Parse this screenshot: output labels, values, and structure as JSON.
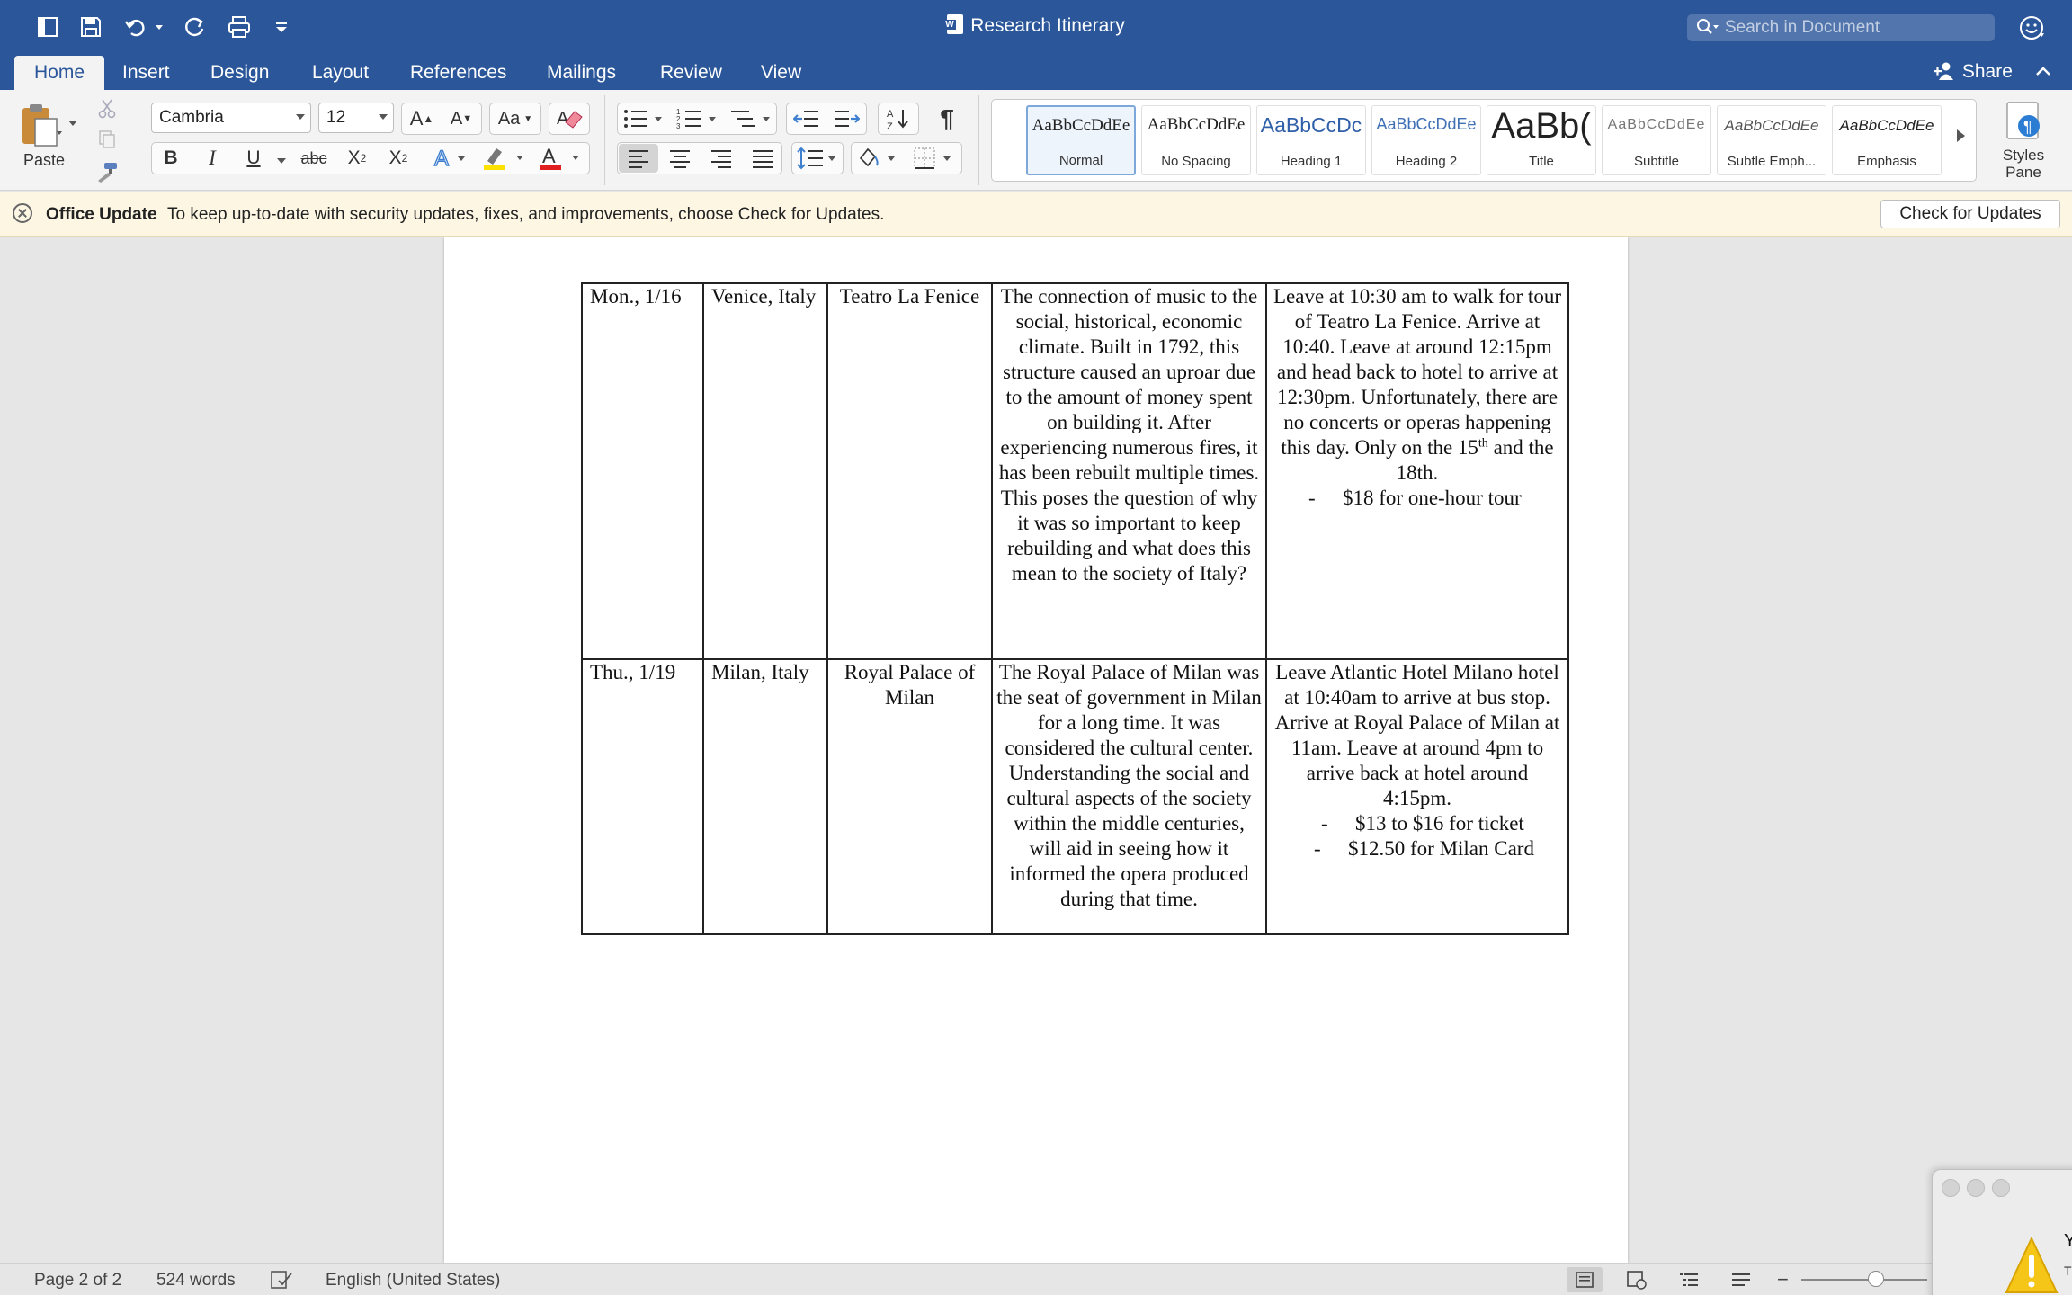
{
  "window": {
    "title": "Research Itinerary"
  },
  "search": {
    "placeholder": "Search in Document"
  },
  "tabs": [
    {
      "label": "Home",
      "active": true
    },
    {
      "label": "Insert"
    },
    {
      "label": "Design"
    },
    {
      "label": "Layout"
    },
    {
      "label": "References"
    },
    {
      "label": "Mailings"
    },
    {
      "label": "Review"
    },
    {
      "label": "View"
    }
  ],
  "share": {
    "label": "Share"
  },
  "ribbon": {
    "paste_label": "Paste",
    "font_name": "Cambria",
    "font_size": "12",
    "bold": "B",
    "italic": "I",
    "underline": "U",
    "strike": "abc",
    "pilcrow": "¶",
    "styles_pane_label": "Styles Pane",
    "styles": [
      {
        "sample": "AaBbCcDdEe",
        "name": "Normal",
        "selected": true
      },
      {
        "sample": "AaBbCcDdEe",
        "name": "No Spacing"
      },
      {
        "sample": "AaBbCcDc",
        "name": "Heading 1"
      },
      {
        "sample": "AaBbCcDdEe",
        "name": "Heading 2"
      },
      {
        "sample": "AaBb(",
        "name": "Title"
      },
      {
        "sample": "AaBbCcDdEe",
        "name": "Subtitle"
      },
      {
        "sample": "AaBbCcDdEe",
        "name": "Subtle Emph..."
      },
      {
        "sample": "AaBbCcDdEe",
        "name": "Emphasis"
      }
    ]
  },
  "update_bar": {
    "title": "Office Update",
    "message": "To keep up-to-date with security updates, fixes, and improvements, choose Check for Updates.",
    "button": "Check for Updates"
  },
  "table": {
    "rows": [
      {
        "date": "Mon., 1/16",
        "city": "Venice, Italy",
        "venue": "Teatro La Fenice",
        "description": "The connection of music to the social, historical, economic climate. Built in 1792, this structure caused an uproar due to the amount of money spent on building it. After experiencing numerous fires, it has been rebuilt multiple times. This poses the question of why it was so important to keep rebuilding and what does this mean to the society of Italy?",
        "plan_before_sup": "Leave at 10:30 am to walk for tour of Teatro La Fenice. Arrive at 10:40. Leave at around 12:15pm and head back to hotel to arrive at 12:30pm. Unfortunately, there are no concerts or operas happening this day. Only on the 15",
        "plan_sup": "th",
        "plan_after_sup": " and the 18th.",
        "costs": [
          "$18 for one-hour tour"
        ]
      },
      {
        "date": "Thu., 1/19",
        "city": "Milan, Italy",
        "venue": "Royal Palace of Milan",
        "description": "The Royal Palace of Milan was the seat of government in Milan for a long time. It was considered the cultural center. Understanding the social and cultural aspects of the society within the middle centuries, will aid in seeing how it informed the opera produced during that time.",
        "plan_before_sup": "Leave Atlantic Hotel Milano hotel at 10:40am to arrive at bus stop. Arrive at Royal Palace of Milan at 11am. Leave at around 4pm to arrive back at hotel around 4:15pm.",
        "plan_sup": "",
        "plan_after_sup": "",
        "costs": [
          "$13 to $16 for ticket",
          "$12.50 for Milan Card"
        ]
      }
    ],
    "bullet": "-"
  },
  "status": {
    "page": "Page 2 of 2",
    "words": "524 words",
    "language": "English (United States)"
  },
  "dialog": {
    "heading_fragment": "Y",
    "text_fragment": "T"
  },
  "colors": {
    "title_bar": "#2b579a",
    "ribbon": "#f3f3f3",
    "update_bar": "#fcf6e3",
    "document_bg": "#e6e6e6",
    "highlight_yellow": "#ffe100",
    "font_red": "#e02020"
  }
}
